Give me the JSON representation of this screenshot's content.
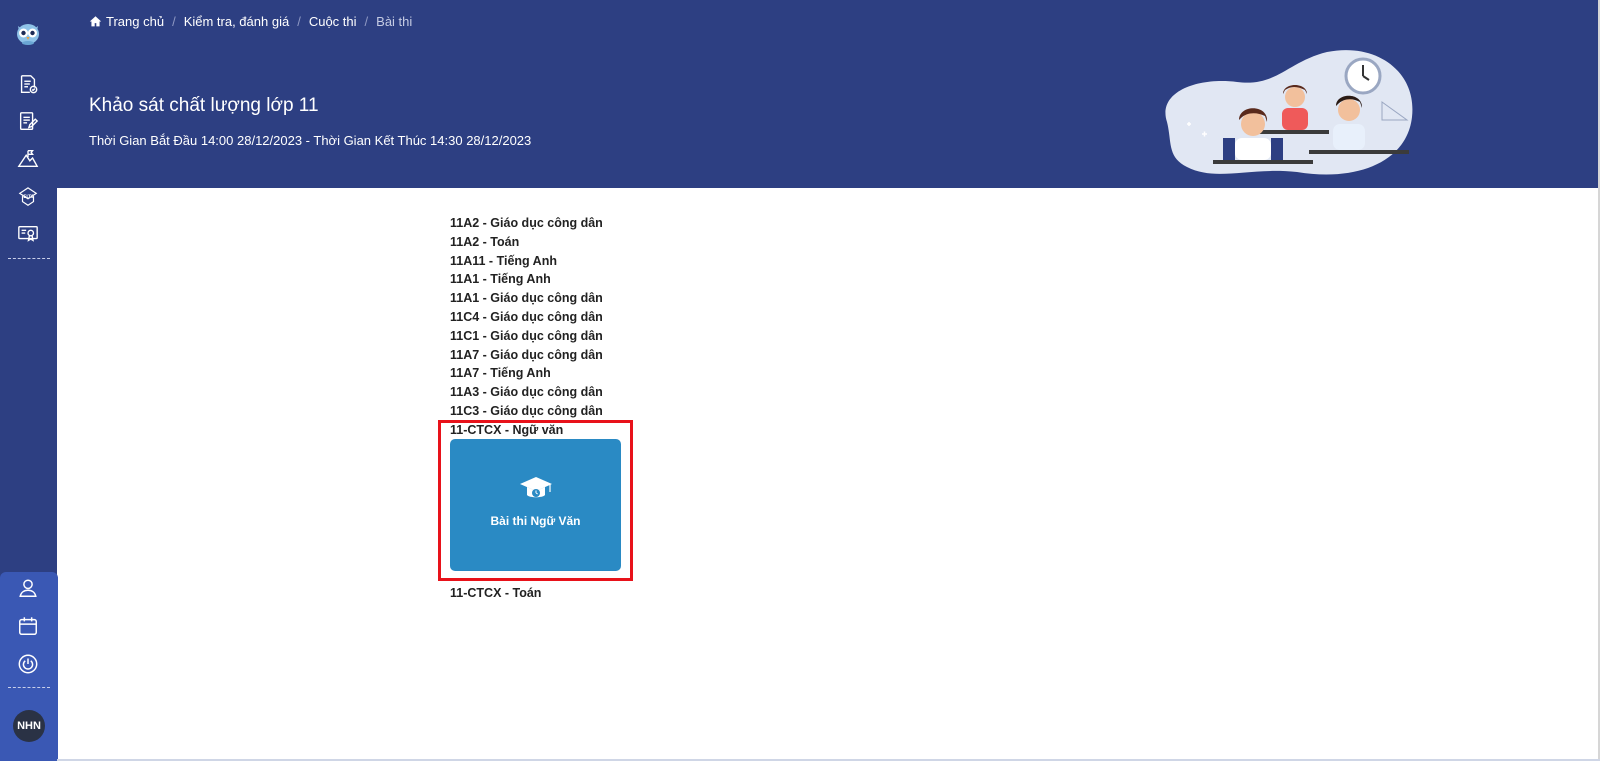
{
  "breadcrumb": {
    "home": "Trang chủ",
    "assess": "Kiểm tra, đánh giá",
    "contest": "Cuộc thi",
    "current": "Bài thi"
  },
  "header": {
    "title": "Khảo sát chất lượng lớp 11",
    "time_range": "Thời Gian Bắt Đầu 14:00 28/12/2023 - Thời Gian Kết Thúc 14:30 28/12/2023"
  },
  "exams": [
    "11A2 - Giáo dục công dân",
    "11A2 - Toán",
    "11A11 - Tiếng Anh",
    "11A1 - Tiếng Anh",
    "11A1 - Giáo dục công dân",
    "11C4 - Giáo dục công dân",
    "11C1 - Giáo dục công dân",
    "11A7 - Giáo dục công dân",
    "11A7 - Tiếng Anh",
    "11A3 - Giáo dục công dân",
    "11C3 - Giáo dục công dân",
    "11-CTCX - Ngữ văn"
  ],
  "exam_card": {
    "label": "Bài thi Ngữ Văn",
    "icon": "graduation-cap-icon"
  },
  "after_card": "11-CTCX - Toán",
  "sidebar": {
    "items": [
      "exam-list-icon",
      "edit-document-icon",
      "mountain-flag-icon",
      "ielts-icon",
      "certificate-icon"
    ],
    "bottom_items": [
      "user-icon",
      "calendar-icon",
      "power-icon"
    ],
    "avatar": "NHN"
  },
  "colors": {
    "header_bg": "#2d3f82",
    "card_bg": "#2a8ac4",
    "highlight": "#e8121a"
  }
}
